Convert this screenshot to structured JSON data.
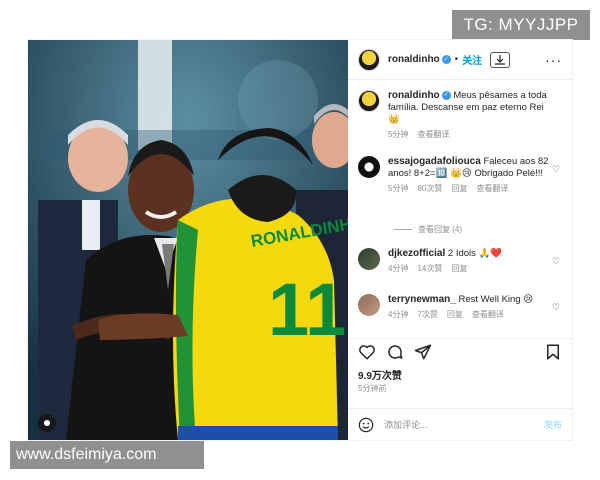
{
  "watermarks": {
    "top": "TG: MYYJJPP",
    "bottom": "www.dsfeimiya.com"
  },
  "header": {
    "username": "ronaldinho",
    "separator": "•",
    "follow_label": "关注",
    "download_icon": "download-icon",
    "more_icon": "more-icon"
  },
  "photo": {
    "jersey_name": "RONALDINH",
    "jersey_number": "11"
  },
  "caption": {
    "username": "ronaldinho",
    "text": "Meus pêsames a toda família. Descanse em paz eterno Rei 👑",
    "time": "5分钟",
    "translate_label": "查看翻译"
  },
  "comments": [
    {
      "username": "essajogadafoliouca",
      "text": "Faleceu aos 82 anos! 8+2=🔟 👑😢 Obrigado Pelé!!!",
      "time": "5分钟",
      "likes": "80次赞",
      "reply_label": "回复",
      "translate_label": "查看翻译",
      "view_replies": "查看回复 (4)"
    },
    {
      "username": "djkezofficial",
      "text": "2 Idols 🙏❤️",
      "time": "4分钟",
      "likes": "14次赞",
      "reply_label": "回复"
    },
    {
      "username": "terrynewman_",
      "text": "Rest Well King 😢",
      "time": "4分钟",
      "likes": "7次赞",
      "reply_label": "回复",
      "translate_label": "查看翻译"
    }
  ],
  "likes_count": "9.9万次赞",
  "posted_time": "5分钟前",
  "add_comment": {
    "placeholder": "添加评论...",
    "post_label": "发布"
  },
  "colors": {
    "link_blue": "#0095f6",
    "verified_blue": "#3897f0",
    "jersey_yellow": "#f5d90a",
    "jersey_green": "#0a8a3a"
  }
}
